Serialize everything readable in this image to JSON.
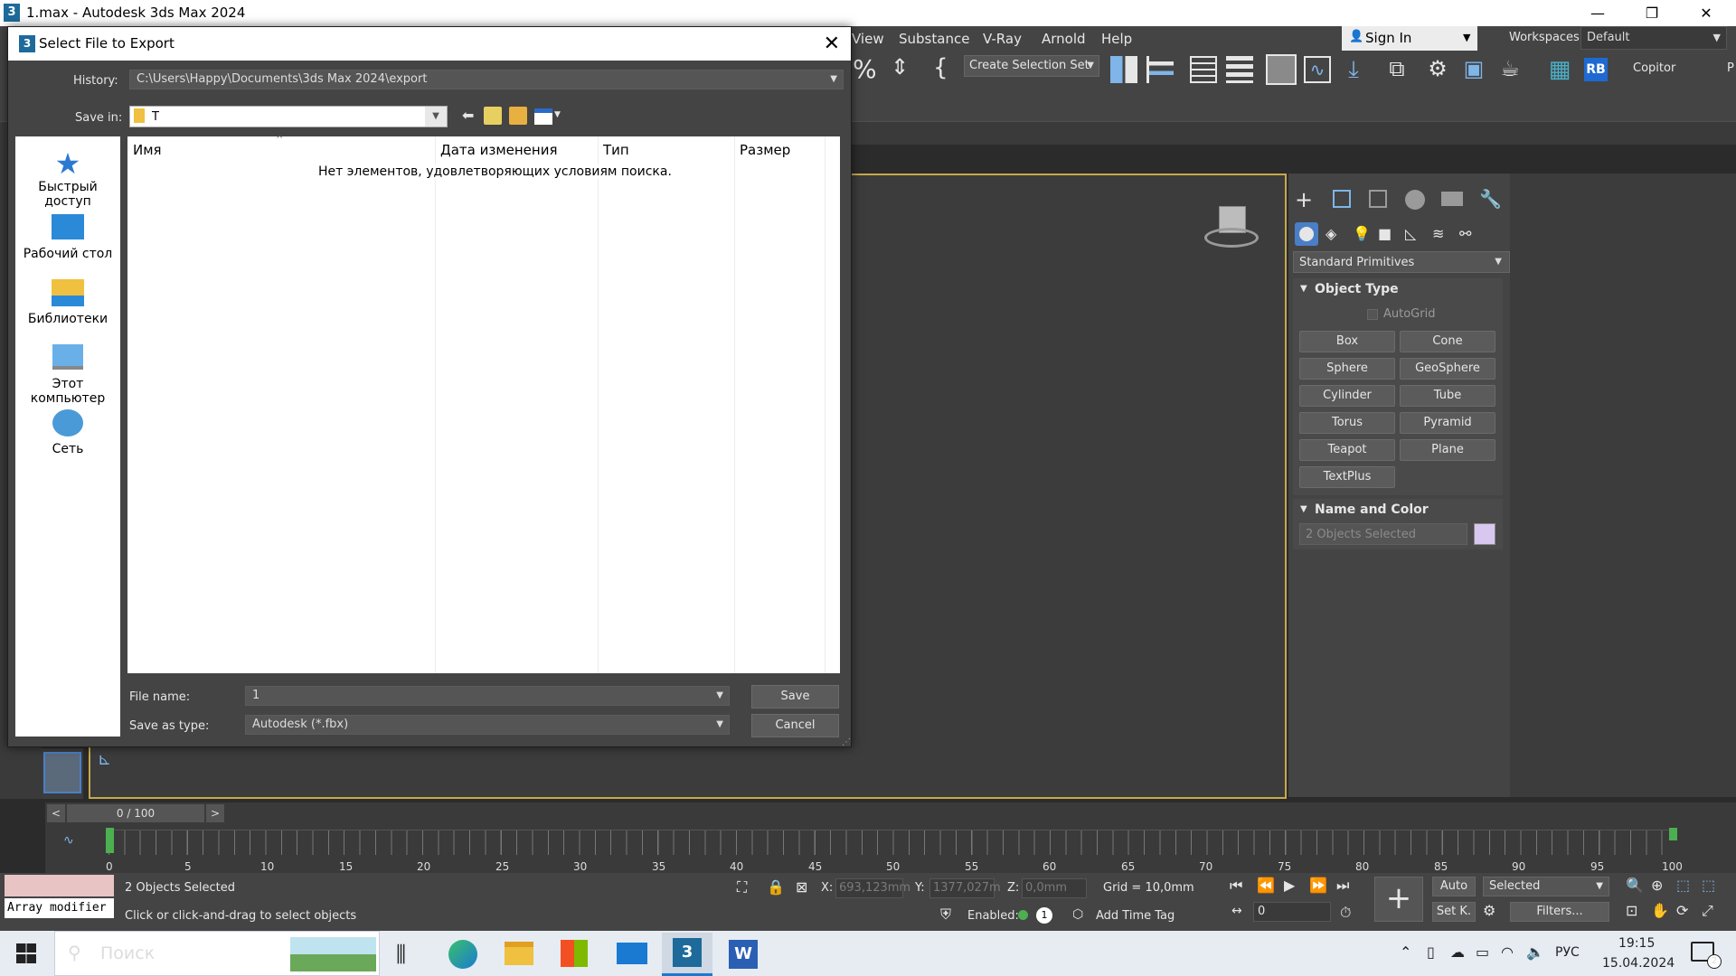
{
  "window": {
    "title": "1.max - Autodesk 3ds Max 2024",
    "minimize": "—",
    "restore": "❐",
    "close": "✕"
  },
  "menu": [
    "View",
    "Substance",
    "V-Ray",
    "Arnold",
    "Help"
  ],
  "signin": {
    "label": "Sign In",
    "workspaces_label": "Workspaces:",
    "workspace_value": "Default"
  },
  "toolbar": {
    "selection_set": "Create Selection Set",
    "copitor": "Copitor",
    "rb": "RB",
    "p": "P"
  },
  "command_panel": {
    "dropdown": "Standard Primitives",
    "object_type": "Object Type",
    "autogrid": "AutoGrid",
    "primitives": [
      "Box",
      "Cone",
      "Sphere",
      "GeoSphere",
      "Cylinder",
      "Tube",
      "Torus",
      "Pyramid",
      "Teapot",
      "Plane",
      "TextPlus"
    ],
    "name_and_color": "Name and Color",
    "name_placeholder": "2 Objects Selected",
    "color": "#d8c8f0"
  },
  "dialog": {
    "title": "Select File to Export",
    "history_label": "History:",
    "history_value": "C:\\Users\\Happy\\Documents\\3ds Max 2024\\export",
    "save_in_label": "Save in:",
    "save_in_value": "T",
    "places": [
      "Быстрый доступ",
      "Рабочий стол",
      "Библиотеки",
      "Этот компьютер",
      "Сеть"
    ],
    "columns": [
      "Имя",
      "Дата изменения",
      "Тип",
      "Размер"
    ],
    "empty_message": "Нет элементов, удовлетворяющих условиям поиска.",
    "file_name_label": "File name:",
    "file_name_value": "1",
    "save_type_label": "Save as type:",
    "save_type_value": "Autodesk (*.fbx)",
    "save_button": "Save",
    "cancel_button": "Cancel"
  },
  "timeline": {
    "frame": "0 / 100",
    "prev": "<",
    "next": ">",
    "ticks": [
      "0",
      "5",
      "10",
      "15",
      "20",
      "25",
      "30",
      "35",
      "40",
      "45",
      "50",
      "55",
      "60",
      "65",
      "70",
      "75",
      "80",
      "85",
      "90",
      "95",
      "100"
    ]
  },
  "status": {
    "script_label": "Array modifier",
    "selected": "2 Objects Selected",
    "hint": "Click or click-and-drag to select objects",
    "x_label": "X:",
    "x_value": "693,123mm",
    "y_label": "Y:",
    "y_value": "1377,027m",
    "z_label": "Z:",
    "z_value": "0,0mm",
    "grid": "Grid = 10,0mm",
    "enabled": "Enabled:",
    "add_time_tag": "Add Time Tag",
    "auto": "Auto",
    "selected_dropdown": "Selected",
    "setk": "Set K.",
    "filters": "Filters...",
    "frame_field": "0"
  },
  "taskbar": {
    "search": "Поиск",
    "lang": "РУС",
    "time": "19:15",
    "date": "15.04.2024",
    "notif": "2"
  }
}
